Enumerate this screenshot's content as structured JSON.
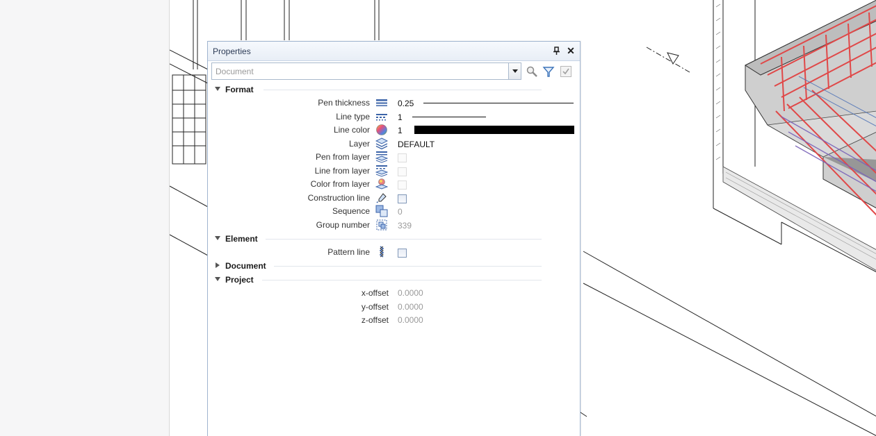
{
  "panel": {
    "title": "Properties",
    "pin_icon": "pin-icon",
    "close_icon": "close-icon",
    "close_glyph": "✕",
    "pin_glyph": "⊥"
  },
  "toolbar": {
    "combo_value": "Document",
    "icons": [
      "search-icon",
      "filter-icon",
      "apply-icon"
    ]
  },
  "sections": {
    "format": "Format",
    "element": "Element",
    "document": "Document",
    "project": "Project"
  },
  "format": {
    "pen_thickness": {
      "label": "Pen thickness",
      "value": "0.25"
    },
    "line_type": {
      "label": "Line type",
      "value": "1"
    },
    "line_color": {
      "label": "Line color",
      "value": "1",
      "swatch": "#000000"
    },
    "layer": {
      "label": "Layer",
      "value": "DEFAULT"
    },
    "pen_from_layer": {
      "label": "Pen from layer",
      "checked": false,
      "enabled": false
    },
    "line_from_layer": {
      "label": "Line from layer",
      "checked": false,
      "enabled": false
    },
    "color_from_layer": {
      "label": "Color from layer",
      "checked": false,
      "enabled": false
    },
    "construction_line": {
      "label": "Construction line",
      "checked": false,
      "enabled": true
    },
    "sequence": {
      "label": "Sequence",
      "value": "0"
    },
    "group_number": {
      "label": "Group number",
      "value": "339"
    }
  },
  "element": {
    "pattern_line": {
      "label": "Pattern line",
      "checked": false,
      "enabled": true
    }
  },
  "project": {
    "x_offset": {
      "label": "x-offset",
      "value": "0.0000"
    },
    "y_offset": {
      "label": "y-offset",
      "value": "0.0000"
    },
    "z_offset": {
      "label": "z-offset",
      "value": "0.0000"
    }
  },
  "colors": {
    "accent": "#3b73b9",
    "rebar_red": "#e04848",
    "panel_border": "#9fb4cf"
  }
}
